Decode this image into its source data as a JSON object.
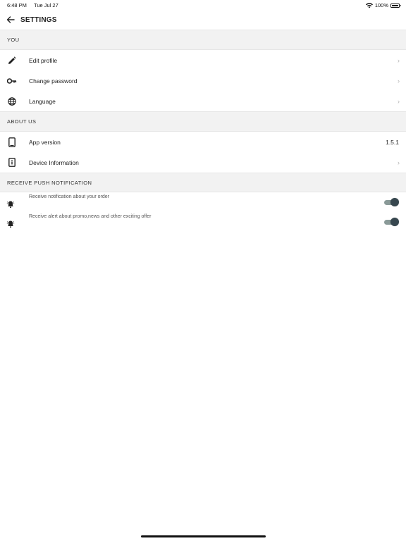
{
  "status_bar": {
    "time": "6:48 PM",
    "date": "Tue Jul 27",
    "battery": "100%",
    "battery_level": 1.0
  },
  "header": {
    "title": "SETTINGS",
    "back_icon": "arrow-left-icon"
  },
  "sections": {
    "you": {
      "title": "YOU",
      "items": [
        {
          "label": "Edit profile",
          "icon": "pencil-icon"
        },
        {
          "label": "Change password",
          "icon": "key-icon"
        },
        {
          "label": "Language",
          "icon": "globe-icon"
        }
      ]
    },
    "about": {
      "title": "ABOUT US",
      "items": [
        {
          "label": "App version",
          "icon": "tablet-icon",
          "value": "1.5.1"
        },
        {
          "label": "Device Information",
          "icon": "info-device-icon"
        }
      ]
    },
    "push": {
      "title": "RECEIVE PUSH NOTIFICATION",
      "items": [
        {
          "label": "Receive notification about your order",
          "icon": "bell-ring-icon",
          "enabled": true
        },
        {
          "label": "Receive alert about promo,news and other exciting offer",
          "icon": "bell-ring-icon",
          "enabled": true
        }
      ]
    }
  },
  "colors": {
    "toggle_knob": "#37474f",
    "toggle_track": "#8a9a98",
    "section_bg": "#f2f2f2"
  }
}
